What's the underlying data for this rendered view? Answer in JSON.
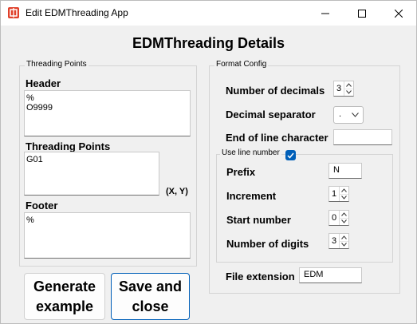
{
  "window": {
    "title": "Edit EDMThreading App"
  },
  "heading": "EDMThreading Details",
  "threading_group": {
    "legend": "Threading Points",
    "header_label": "Header",
    "header_value": "%\nO9999",
    "points_label": "Threading Points",
    "points_value": "G01",
    "points_hint": "(X, Y)",
    "footer_label": "Footer",
    "footer_value": "%"
  },
  "format_group": {
    "legend": "Format Config",
    "decimals_label": "Number of decimals",
    "decimals_value": "3",
    "separator_label": "Decimal separator",
    "separator_value": ".",
    "eol_label": "End of line character",
    "eol_value": "",
    "line_number_legend": "Use line number",
    "line_number_checked": true,
    "prefix_label": "Prefix",
    "prefix_value": "N",
    "increment_label": "Increment",
    "increment_value": "1",
    "start_label": "Start number",
    "start_value": "0",
    "digits_label": "Number of digits",
    "digits_value": "3",
    "extension_label": "File extension",
    "extension_value": "EDM"
  },
  "buttons": {
    "generate_label": "Generate example",
    "save_label": "Save and close"
  },
  "icons": {
    "app": "app-icon",
    "minimize": "minimize-icon",
    "maximize": "maximize-icon",
    "close": "close-icon"
  },
  "colors": {
    "accent": "#005fb8",
    "app_icon": "#e0402a"
  }
}
